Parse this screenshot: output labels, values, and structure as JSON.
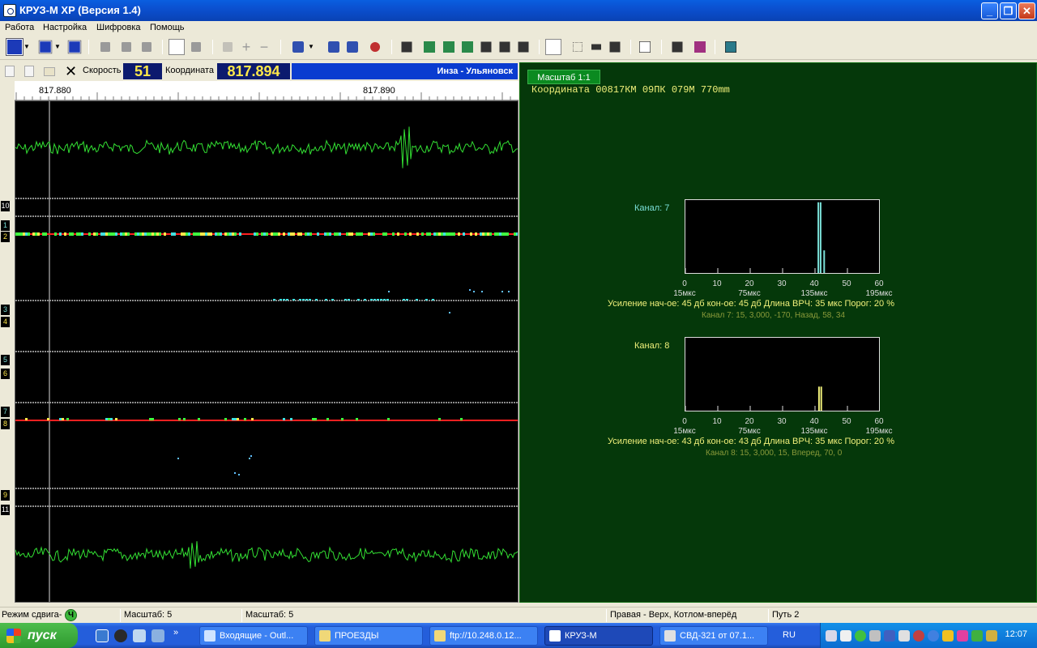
{
  "window": {
    "title": "КРУЗ-М XP (Версия 1.4)"
  },
  "menu": [
    "Работа",
    "Настройка",
    "Шифровка",
    "Помощь"
  ],
  "infobar": {
    "speed_label": "Скорость",
    "speed_value": "51",
    "coord_label": "Координата",
    "coord_value": "817.894",
    "route": "Инза - Ульяновск"
  },
  "ruler": {
    "ticks": [
      "817.880",
      "817.890"
    ]
  },
  "channel_labels": [
    "10",
    "1",
    "2",
    "2",
    "3",
    "4",
    "5",
    "6",
    "7",
    "8",
    "9",
    "11"
  ],
  "right_panel": {
    "scale_tab": "Масштаб 1:1",
    "coordinate": "Координата   00817КМ 09ПК 079М 770mm",
    "axis_ticks": [
      "0",
      "10",
      "20",
      "30",
      "40",
      "50",
      "60"
    ],
    "axis_sub": [
      "15мкс",
      "75мкс",
      "135мкс",
      "195мкс"
    ],
    "channels": [
      {
        "title": "Канал: 7",
        "gain": "Усиление нач-ое: 45 дб  кон-ое: 45 дб  Длина ВРЧ: 35 мкс  Порог: 20 %",
        "details": "Канал 7: 15, 3,000, -170, Назад, 58, 34",
        "color": "#7be0d8",
        "peaks": [
          {
            "t": 41.2,
            "h": 0.97
          },
          {
            "t": 41.9,
            "h": 0.97
          },
          {
            "t": 43.0,
            "h": 0.31
          }
        ]
      },
      {
        "title": "Канал: 8",
        "gain": "Усиление нач-ое: 43 дб  кон-ое: 43 дб  Длина ВРЧ: 35 мкс  Порог: 20 %",
        "details": "Канал 8: 15, 3,000, 15, Вперед, 70, 0",
        "color": "#f0f07a",
        "peaks": [
          {
            "t": 41.4,
            "h": 0.33
          },
          {
            "t": 42.1,
            "h": 0.33
          }
        ]
      }
    ]
  },
  "status": {
    "mode": "Режим сдвига-",
    "mode_badge": "Ч",
    "scale1": "Масштаб: 5",
    "scale2": "Масштаб: 5",
    "direction": "Правая - Верх, Котлом-вперёд",
    "track": "Путь 2"
  },
  "taskbar": {
    "start": "пуск",
    "tasks": [
      "Входящие - Outl...",
      "ПРОЕЗДЫ",
      "ftp://10.248.0.12...",
      "КРУЗ-М",
      "СВД-321 от 07.1..."
    ],
    "lang": "RU",
    "clock": "12:07"
  }
}
